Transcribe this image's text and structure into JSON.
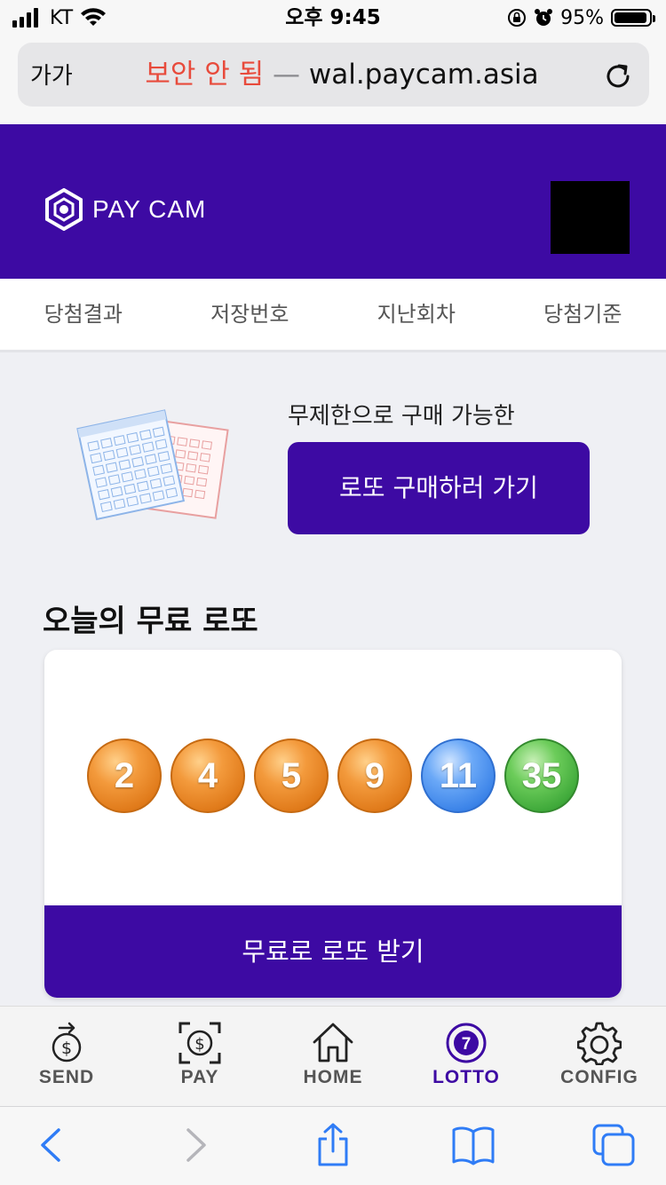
{
  "status_bar": {
    "carrier": "KT",
    "time": "오후 9:45",
    "battery": "95%"
  },
  "browser": {
    "text_size_label": "가가",
    "insecure_label": "보안 안 됨",
    "separator": "—",
    "domain": "wal.paycam.asia"
  },
  "header": {
    "brand": "PAY CAM"
  },
  "tabs": [
    {
      "label": "당첨결과"
    },
    {
      "label": "저장번호"
    },
    {
      "label": "지난회차"
    },
    {
      "label": "당첨기준"
    }
  ],
  "promo": {
    "text": "무제한으로 구매 가능한",
    "button_label": "로또 구매하러 가기"
  },
  "free_lotto": {
    "title": "오늘의 무료 로또",
    "numbers": [
      "2",
      "4",
      "5",
      "9",
      "11",
      "35"
    ],
    "button_label": "무료로 로또 받기"
  },
  "app_nav": [
    {
      "label": "SEND",
      "icon": "send-dollar-icon"
    },
    {
      "label": "PAY",
      "icon": "scan-pay-icon"
    },
    {
      "label": "HOME",
      "icon": "home-icon"
    },
    {
      "label": "LOTTO",
      "icon": "lotto-seven-icon",
      "active": true,
      "badge": "7"
    },
    {
      "label": "CONFIG",
      "icon": "gear-icon"
    }
  ],
  "colors": {
    "brand": "#3d0aa3",
    "insecure": "#e84b3c",
    "ball_orange": "#e07a1a",
    "ball_blue": "#3b83e8",
    "ball_green": "#3fa93a",
    "ios_blue": "#2f7cf6"
  }
}
